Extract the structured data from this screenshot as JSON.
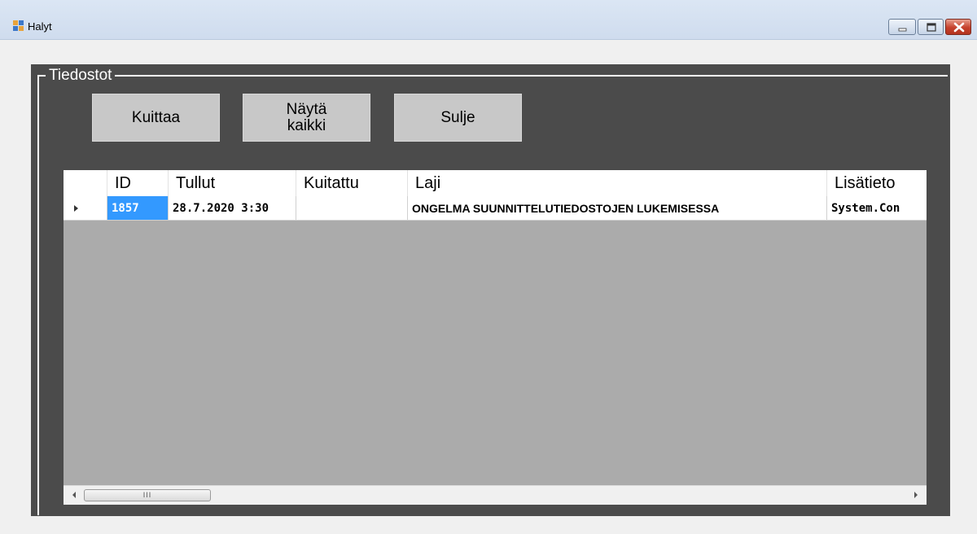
{
  "window": {
    "title": "Halyt",
    "icon": "app-window-icon",
    "controls": [
      "minimize-icon",
      "maximize-icon",
      "close-icon"
    ]
  },
  "group": {
    "title": "Tiedostot"
  },
  "buttons": {
    "kuittaa": "Kuittaa",
    "nayta_line1": "Näytä",
    "nayta_line2": "kaikki",
    "sulje": "Sulje"
  },
  "grid": {
    "columns": [
      "ID",
      "Tullut",
      "Kuitattu",
      "Laji",
      "Lisätieto"
    ],
    "rows": [
      {
        "id": "1857",
        "tullut": "28.7.2020 3:30",
        "kuitattu": "",
        "laji": "ONGELMA SUUNNITTELUTIEDOSTOJEN LUKEMISESSA",
        "lisatieto": "System.Con"
      }
    ],
    "scroll_thumb_grip": "III"
  },
  "colors": {
    "groupbox_bg": "#4b4b4b",
    "grid_bg": "#ababab",
    "selection": "#3399ff",
    "button_bg": "#c8c8c8"
  }
}
